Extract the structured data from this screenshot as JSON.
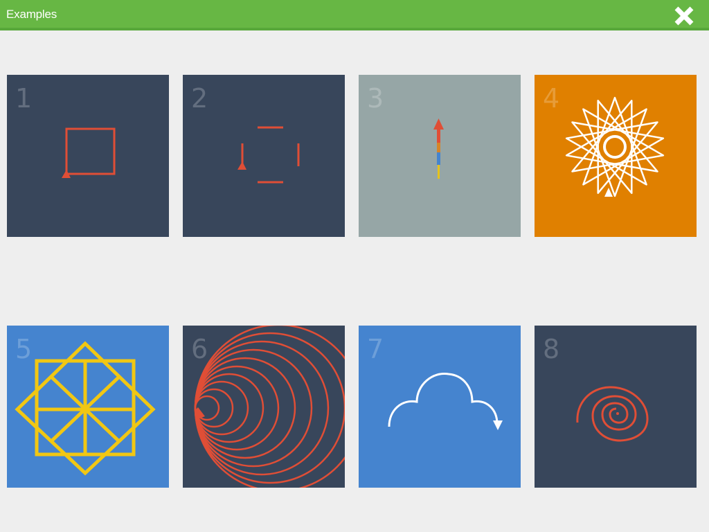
{
  "header": {
    "title": "Examples",
    "close_icon": "close-x-icon"
  },
  "examples": [
    {
      "number": "1",
      "bg": "#38465b",
      "icon": "square-path-icon"
    },
    {
      "number": "2",
      "bg": "#38465b",
      "icon": "dashed-square-icon"
    },
    {
      "number": "3",
      "bg": "#96a6a6",
      "icon": "vertical-arrow-icon"
    },
    {
      "number": "4",
      "bg": "#e08000",
      "icon": "star-pattern-icon"
    },
    {
      "number": "5",
      "bg": "#4584cf",
      "icon": "octagram-squares-icon"
    },
    {
      "number": "6",
      "bg": "#38465b",
      "icon": "concentric-circles-icon"
    },
    {
      "number": "7",
      "bg": "#4584cf",
      "icon": "cloud-arc-icon"
    },
    {
      "number": "8",
      "bg": "#38465b",
      "icon": "spiral-icon"
    }
  ],
  "colors": {
    "header": "#67b744",
    "page": "#eeeeee",
    "red": "#e04e36",
    "yellow": "#f1c713",
    "white": "#ffffff"
  }
}
